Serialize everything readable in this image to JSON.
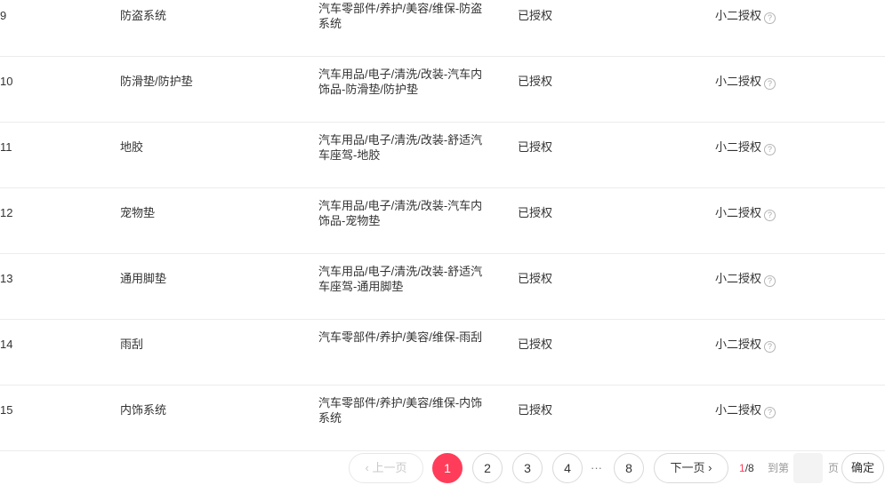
{
  "rows": [
    {
      "index": "9",
      "name": "防盗系统",
      "path": "汽车零部件/养护/美容/维保-防盗系统",
      "status": "已授权",
      "auth_type": "小二授权"
    },
    {
      "index": "10",
      "name": "防滑垫/防护垫",
      "path": "汽车用品/电子/清洗/改装-汽车内饰品-防滑垫/防护垫",
      "status": "已授权",
      "auth_type": "小二授权"
    },
    {
      "index": "11",
      "name": "地胶",
      "path": "汽车用品/电子/清洗/改装-舒适汽车座驾-地胶",
      "status": "已授权",
      "auth_type": "小二授权"
    },
    {
      "index": "12",
      "name": "宠物垫",
      "path": "汽车用品/电子/清洗/改装-汽车内饰品-宠物垫",
      "status": "已授权",
      "auth_type": "小二授权"
    },
    {
      "index": "13",
      "name": "通用脚垫",
      "path": "汽车用品/电子/清洗/改装-舒适汽车座驾-通用脚垫",
      "status": "已授权",
      "auth_type": "小二授权"
    },
    {
      "index": "14",
      "name": "雨刮",
      "path": "汽车零部件/养护/美容/维保-雨刮",
      "status": "已授权",
      "auth_type": "小二授权"
    },
    {
      "index": "15",
      "name": "内饰系统",
      "path": "汽车零部件/养护/美容/维保-内饰系统",
      "status": "已授权",
      "auth_type": "小二授权"
    }
  ],
  "icons": {
    "help": "question-circle-icon",
    "prev": "chevron-left-icon",
    "next": "chevron-right-icon"
  },
  "help_glyph": "?",
  "pagination": {
    "prev_label": "上一页",
    "next_label": "下一页",
    "pages": [
      "1",
      "2",
      "3",
      "4"
    ],
    "ellipsis": "···",
    "last_page": "8",
    "current": "1",
    "total": "/8",
    "goto_prefix": "到第",
    "goto_suffix": "页",
    "goto_value": "",
    "confirm_label": "确定"
  },
  "colors": {
    "accent": "#ff3d5a",
    "divider": "#ececec"
  }
}
